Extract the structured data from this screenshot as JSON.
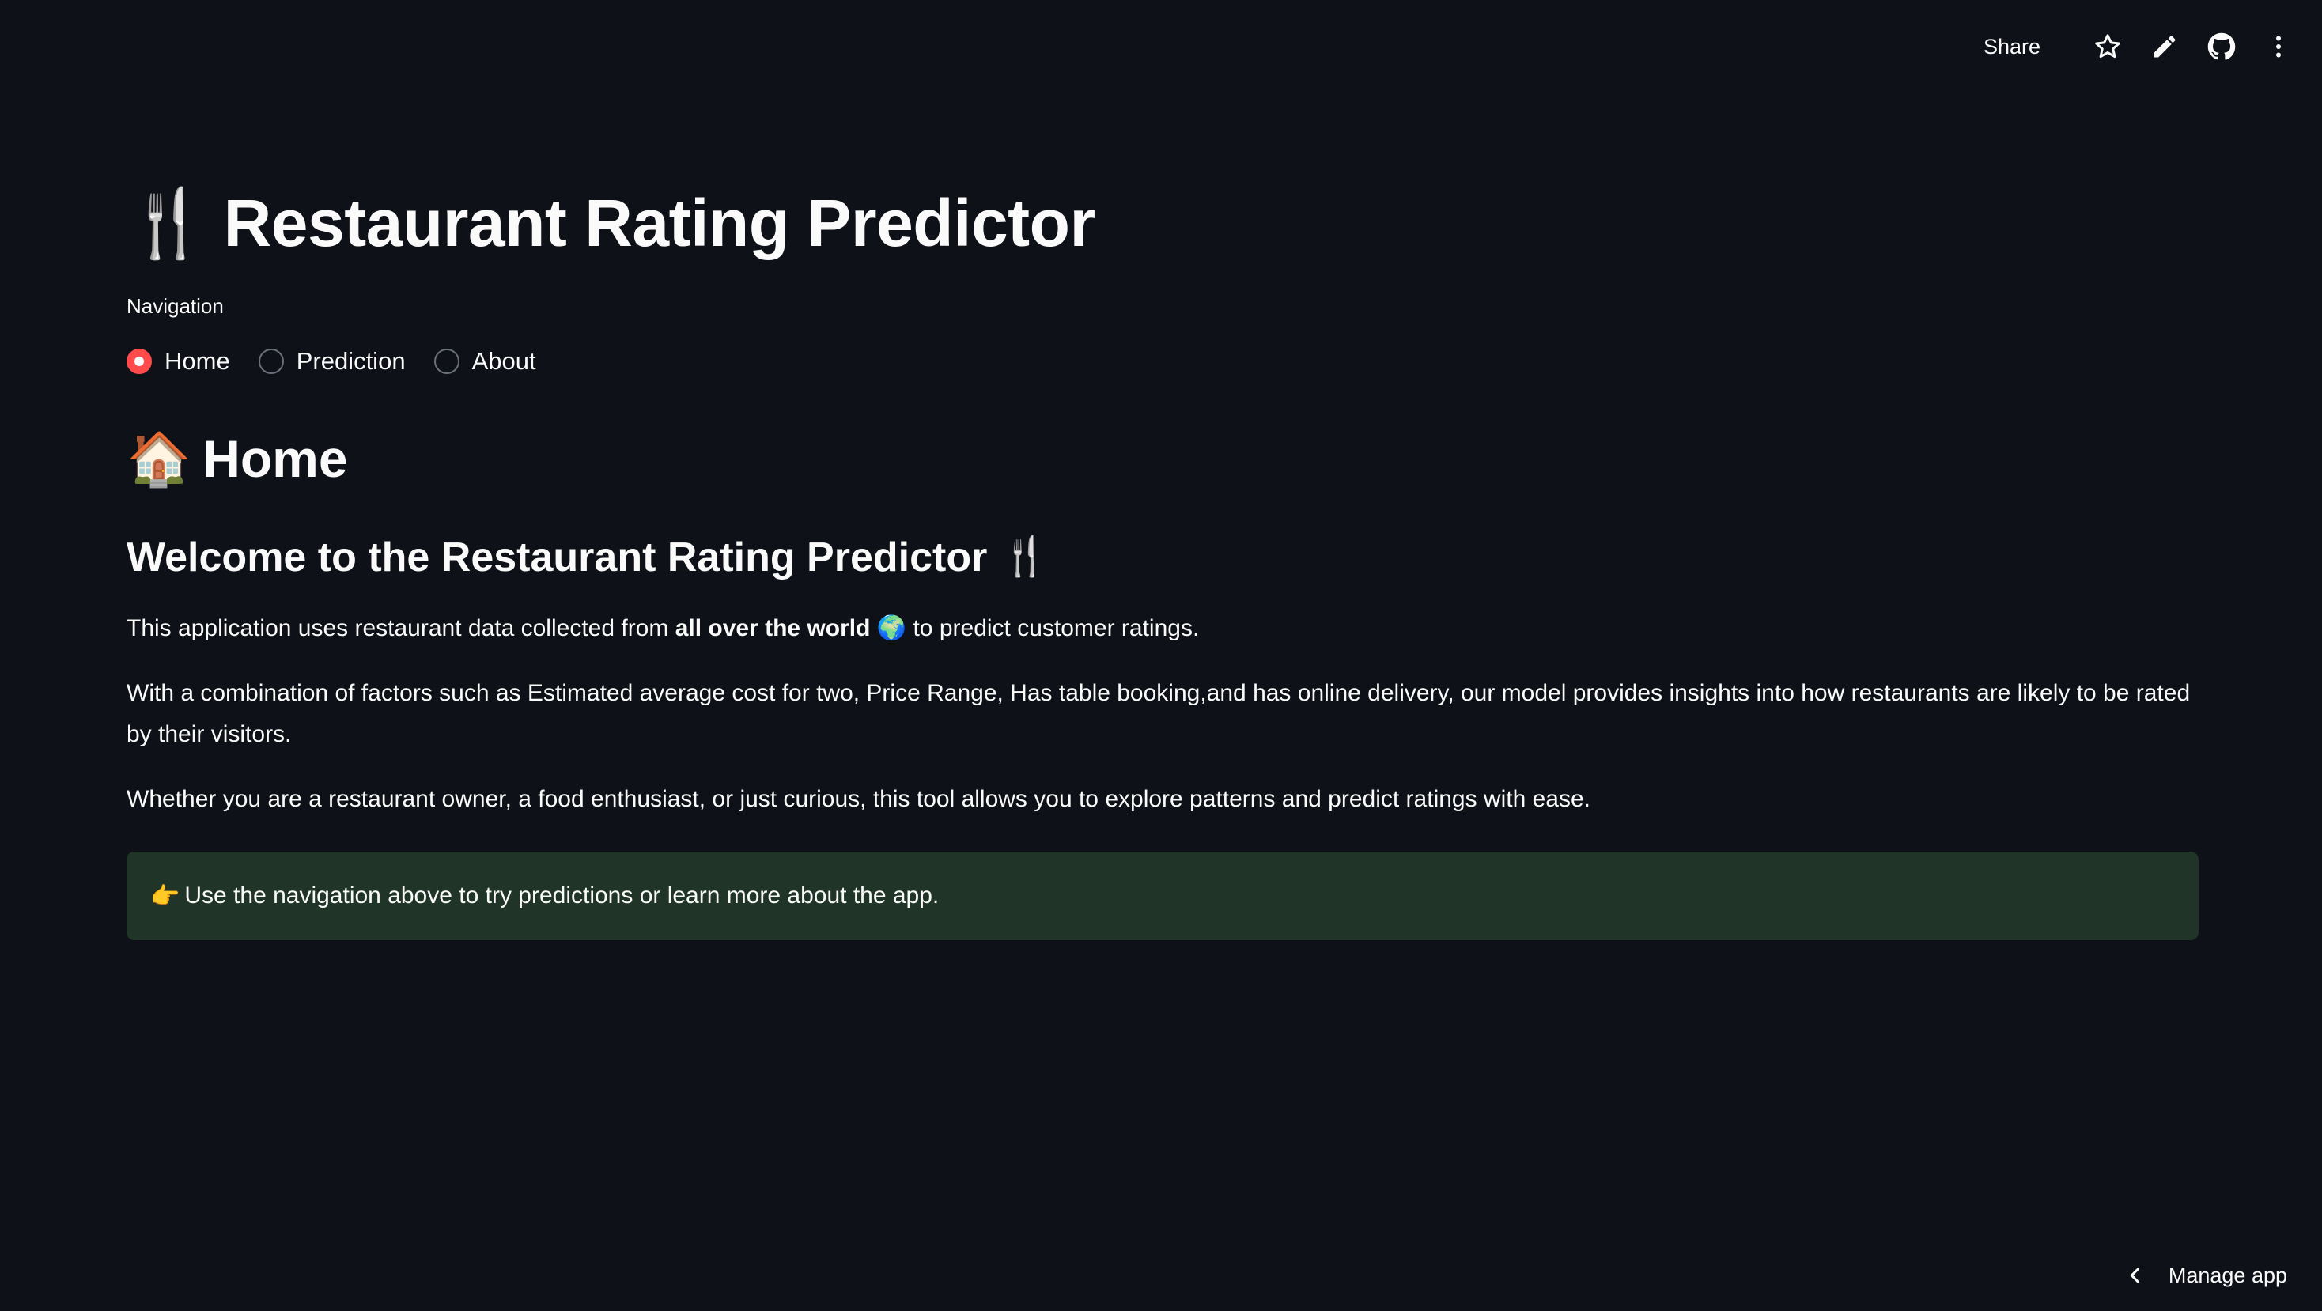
{
  "toolbar": {
    "share_label": "Share",
    "icons": [
      "star-icon",
      "pencil-icon",
      "github-icon",
      "kebab-menu-icon"
    ]
  },
  "header": {
    "title_emoji": "🍴",
    "title": "Restaurant Rating Predictor"
  },
  "navigation": {
    "label": "Navigation",
    "options": [
      {
        "label": "Home",
        "selected": true
      },
      {
        "label": "Prediction",
        "selected": false
      },
      {
        "label": "About",
        "selected": false
      }
    ]
  },
  "content": {
    "section_emoji": "🏠",
    "section_title": "Home",
    "welcome_title": "Welcome to the Restaurant Rating Predictor",
    "welcome_emoji": "🍴",
    "p1_before": "This application uses restaurant data collected from ",
    "p1_bold": "all over the world",
    "p1_emoji": "🌍",
    "p1_after": " to predict customer ratings.",
    "p2": "With a combination of factors such as Estimated average cost for two, Price Range, Has table booking,and has online delivery, our model provides insights into how restaurants are likely to be rated by their visitors.",
    "p3": "Whether you are a restaurant owner, a food enthusiast, or just curious, this tool allows you to explore patterns and predict ratings with ease.",
    "callout_emoji": "👉",
    "callout_text": "Use the navigation above to try predictions or learn more about the app."
  },
  "footer": {
    "manage_label": "Manage app"
  },
  "colors": {
    "background": "#0e1117",
    "accent": "#ff4b4b",
    "callout_bg": "#203528"
  }
}
